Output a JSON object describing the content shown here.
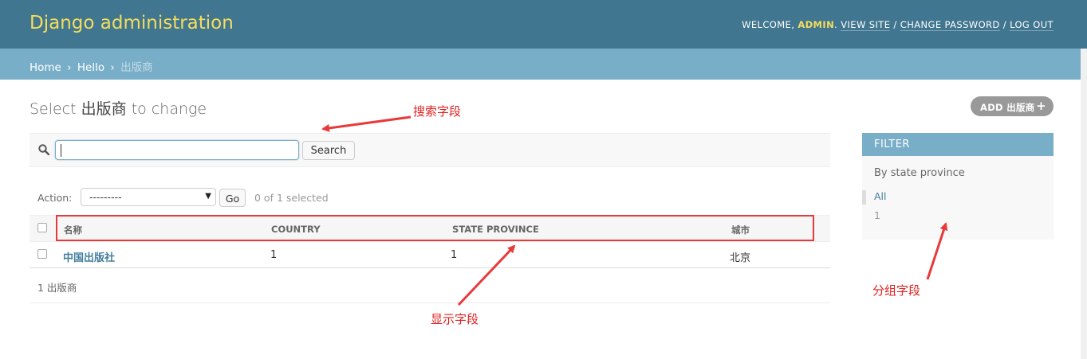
{
  "header": {
    "site_title": "Django administration",
    "welcome": "WELCOME, ",
    "username": "ADMIN",
    "view_site": "VIEW SITE",
    "change_password": "CHANGE PASSWORD",
    "log_out": "LOG OUT",
    "sep": " / "
  },
  "breadcrumbs": {
    "items": [
      "Home",
      "Hello",
      "出版商"
    ],
    "separator": "›"
  },
  "content": {
    "title_prefix": "Select ",
    "model_name": "出版商",
    "title_suffix": " to change",
    "add_button": "ADD 出版商",
    "add_icon": "+"
  },
  "search": {
    "value": "",
    "button": "Search",
    "icon": "search-icon"
  },
  "actions": {
    "label": "Action:",
    "selected_option": "---------",
    "go_button": "Go",
    "selection_counter": "0 of 1 selected"
  },
  "table": {
    "headers": [
      "名称",
      "COUNTRY",
      "STATE PROVINCE",
      "城市"
    ],
    "rows": [
      [
        "中国出版社",
        "1",
        "1",
        "北京"
      ]
    ]
  },
  "paginator": "1 出版商",
  "filter": {
    "title": "FILTER",
    "heading": "By state province",
    "options": [
      "All",
      "1"
    ]
  },
  "annotations": {
    "search_field": "搜索字段",
    "display_field": "显示字段",
    "group_field": "分组字段",
    "color": "#e83a3a"
  },
  "colors": {
    "header_bg": "#417690",
    "breadcrumb_bg": "#79aec8",
    "title_yellow": "#f5dd5d",
    "link": "#447e9b"
  }
}
